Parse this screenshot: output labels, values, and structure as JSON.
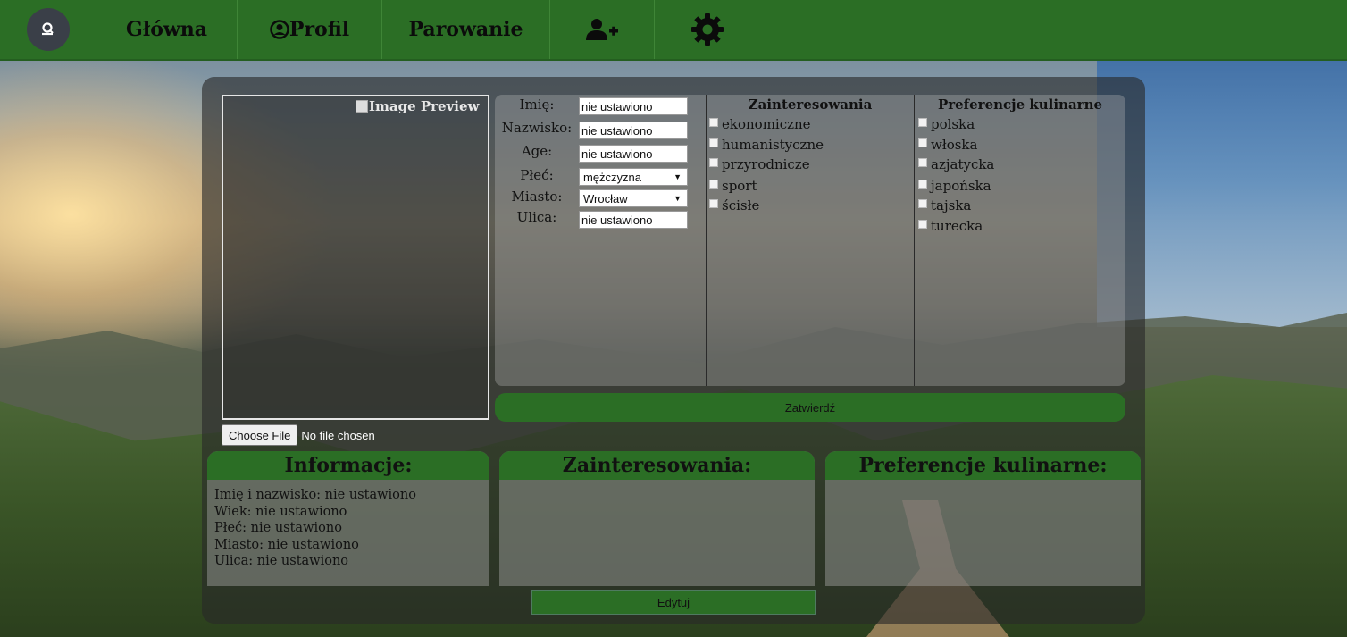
{
  "nav": {
    "home": "Główna",
    "profile": "Profil",
    "pairing": "Parowanie"
  },
  "preview": {
    "alt_text": "Image Preview",
    "choose_file": "Choose File",
    "no_file": "No file chosen"
  },
  "form": {
    "first_name_label": "Imię:",
    "first_name_value": "nie ustawiono",
    "last_name_label": "Nazwisko:",
    "last_name_value": "nie ustawiono",
    "age_label": "Age:",
    "age_value": "nie ustawiono",
    "gender_label": "Płeć:",
    "gender_value": "mężczyzna",
    "city_label": "Miasto:",
    "city_value": "Wrocław",
    "street_label": "Ulica:",
    "street_value": "nie ustawiono"
  },
  "interests": {
    "title": "Zainteresowania",
    "items": [
      "ekonomiczne",
      "humanistyczne",
      "przyrodnicze",
      "sport",
      "ścisłe"
    ]
  },
  "cuisine": {
    "title": "Preferencje kulinarne",
    "items": [
      "polska",
      "włoska",
      "azjatycka",
      "japońska",
      "tajska",
      "turecka"
    ]
  },
  "submit_label": "Zatwierdź",
  "info": {
    "title": "Informacje:",
    "lines": [
      "Imię i nazwisko: nie ustawiono",
      "Wiek: nie ustawiono",
      "Płeć: nie ustawiono",
      "Miasto: nie ustawiono",
      "Ulica: nie ustawiono"
    ]
  },
  "interests_summary": {
    "title": "Zainteresowania:"
  },
  "cuisine_summary": {
    "title": "Preferencje kulinarne:"
  },
  "edit_label": "Edytuj",
  "colors": {
    "nav_green": "#2b6e25",
    "panel_dark": "#282828"
  },
  "icons": [
    "search-user-icon",
    "user-circle-icon",
    "add-user-icon",
    "gear-icon"
  ]
}
